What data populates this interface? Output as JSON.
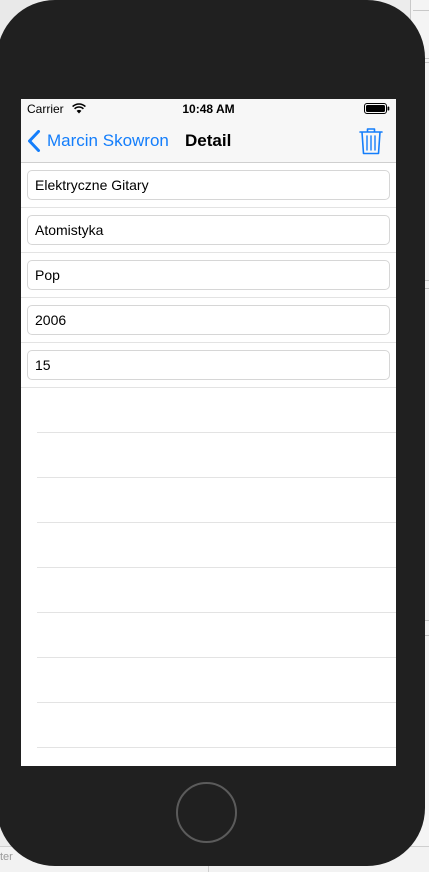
{
  "status_bar": {
    "carrier": "Carrier",
    "time": "10:48 AM"
  },
  "nav": {
    "back_label": "Marcin Skowron",
    "title": "Detail",
    "back_icon": "chevron-left-icon",
    "action_icon": "trash-icon"
  },
  "fields": [
    {
      "value": "Elektryczne Gitary"
    },
    {
      "value": "Atomistyka"
    },
    {
      "value": "Pop"
    },
    {
      "value": "2006"
    },
    {
      "value": "15"
    }
  ],
  "background": {
    "filter_text": "ter"
  },
  "colors": {
    "tint": "#147efb",
    "device": "#202020"
  }
}
